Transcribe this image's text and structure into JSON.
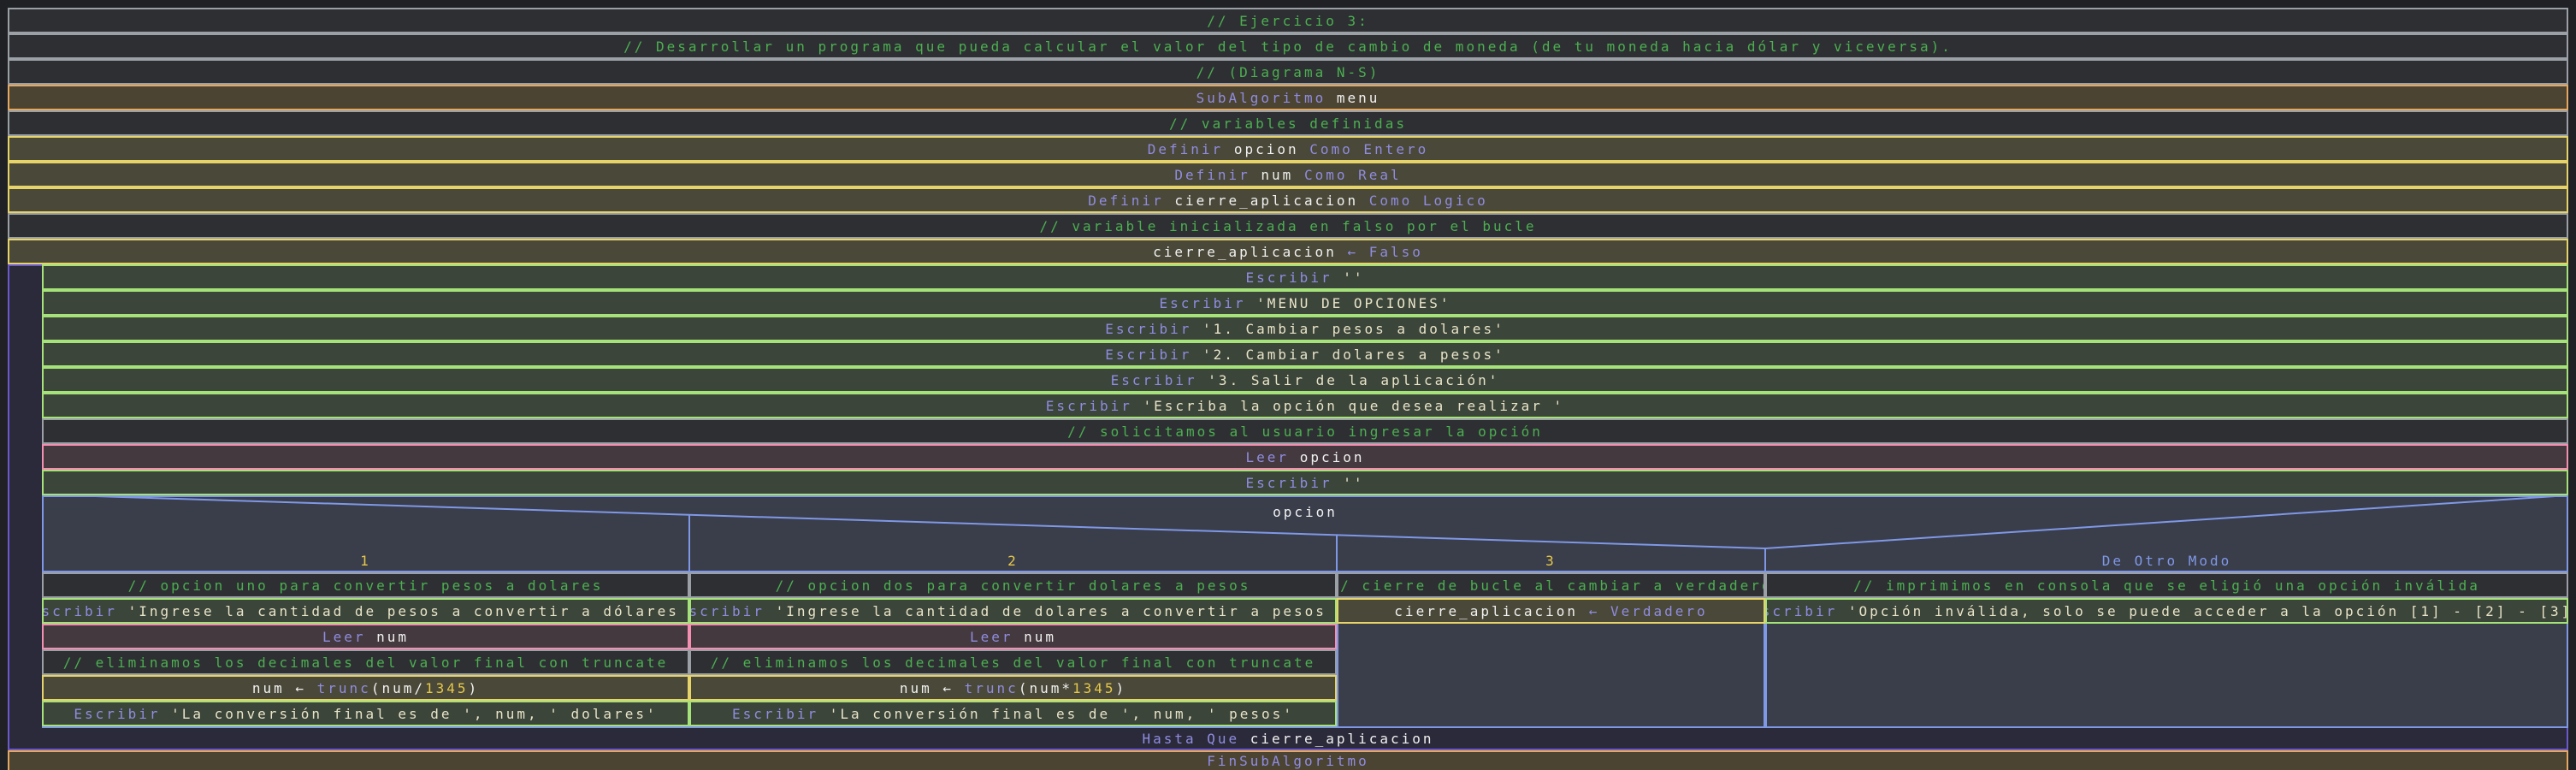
{
  "header": {
    "line1": "// Ejercicio 3:",
    "line2": "// Desarrollar un programa que pueda calcular el valor del tipo de cambio de moneda (de tu moneda hacia dólar y viceversa).",
    "line3": "// (Diagrama N-S)"
  },
  "sub": {
    "kw": "SubAlgoritmo",
    "name": "menu",
    "end": "FinSubAlgoritmo"
  },
  "comments": {
    "vars": "// variables definidas",
    "init": "// variable inicializada en falso por el bucle",
    "ask": "// solicitamos al usuario ingresar la opción"
  },
  "defs": [
    {
      "kw1": "Definir",
      "var": "opcion",
      "kw2": "Como Entero"
    },
    {
      "kw1": "Definir",
      "var": "num",
      "kw2": "Como Real"
    },
    {
      "kw1": "Definir",
      "var": "cierre_aplicacion",
      "kw2": "Como Logico"
    }
  ],
  "init": {
    "var": "cierre_aplicacion",
    "op": "←",
    "val": "Falso"
  },
  "writes": [
    {
      "kw": "Escribir",
      "txt": "''"
    },
    {
      "kw": "Escribir",
      "txt": "'MENU DE OPCIONES'"
    },
    {
      "kw": "Escribir",
      "txt": "'1. Cambiar pesos a dolares'"
    },
    {
      "kw": "Escribir",
      "txt": "'2. Cambiar dolares a pesos'"
    },
    {
      "kw": "Escribir",
      "txt": "'3. Salir de la aplicación'"
    },
    {
      "kw": "Escribir",
      "txt": "'Escriba la opción que desea realizar '"
    }
  ],
  "read": {
    "kw": "Leer",
    "var": "opcion"
  },
  "blank": {
    "kw": "Escribir",
    "txt": "''"
  },
  "switch": {
    "var": "opcion",
    "case1": "1",
    "case2": "2",
    "case3": "3",
    "other": "De Otro Modo",
    "c1": {
      "cmt": "// opcion uno para convertir pesos a dolares",
      "w_kw": "Escribir",
      "w_txt": "'Ingrese la cantidad de pesos a convertir a dólares '",
      "r_kw": "Leer",
      "r_var": "num",
      "cmt2": "// eliminamos los decimales del valor final con truncate",
      "a1": "num ← ",
      "a_fn": "trunc",
      "a_open": "(num/",
      "a_num": "1345",
      "a_close": ")",
      "e_kw": "Escribir",
      "e_txt": "'La conversión final es de ', num, ' dolares'"
    },
    "c2": {
      "cmt": "// opcion dos para convertir dolares a pesos",
      "w_kw": "Escribir",
      "w_txt": "'Ingrese la cantidad de dolares a convertir a pesos '",
      "r_kw": "Leer",
      "r_var": "num",
      "cmt2": "// eliminamos los decimales del valor final con truncate",
      "a1": "num ← ",
      "a_fn": "trunc",
      "a_open": "(num*",
      "a_num": "1345",
      "a_close": ")",
      "e_kw": "Escribir",
      "e_txt": "'La conversión final es de ', num, ' pesos'"
    },
    "c3": {
      "cmt": "// cierre de bucle al cambiar a verdadero",
      "var": "cierre_aplicacion",
      "op": "←",
      "val": "Verdadero"
    },
    "c4": {
      "cmt": "// imprimimos en consola que se eligió una opción inválida",
      "w_kw": "Escribir",
      "w_txt": "'Opción inválida, solo se puede acceder a la opción [1] - [2] - [3]'"
    }
  },
  "until": {
    "kw": "Hasta Que",
    "var": "cierre_aplicacion"
  }
}
